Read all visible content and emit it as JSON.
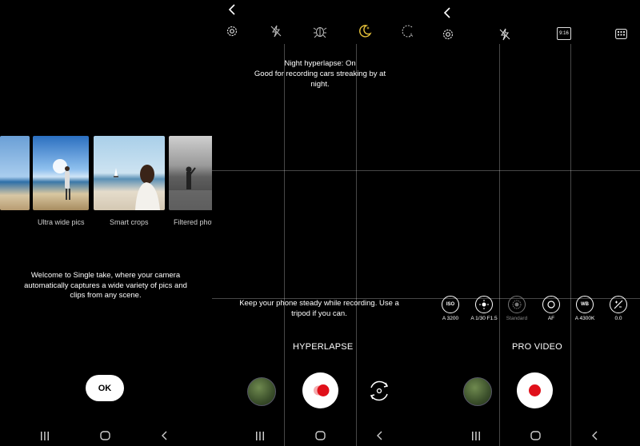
{
  "panel_single_take": {
    "thumbnails": [
      {
        "label": ""
      },
      {
        "label": "Ultra wide pics"
      },
      {
        "label": "Smart crops"
      },
      {
        "label": "Filtered phot"
      }
    ],
    "welcome_text": "Welcome to Single take, where your camera automatically captures a wide variety of pics and clips from any scene.",
    "ok_label": "OK"
  },
  "panel_hyperlapse": {
    "top_icons": [
      "settings-icon",
      "flash-off-icon",
      "night-bug-icon",
      "night-hyperlapse-icon",
      "auto-fps-icon"
    ],
    "night_title": "Night hyperlapse: On",
    "night_desc": "Good for recording cars streaking by at night.",
    "tip": "Keep your phone steady while recording. Use a tripod if you can.",
    "mode_label": "HYPERLAPSE",
    "accent_color": "#e8c33a",
    "record_color": "#e0101a"
  },
  "panel_pro_video": {
    "top_icons": [
      "settings-icon",
      "flash-off-icon",
      "aspect-ratio-icon",
      "grid-menu-icon"
    ],
    "aspect_label": "9:16",
    "controls": [
      {
        "name": "iso",
        "icon_text": "ISO",
        "value": "A 3200",
        "enabled": true
      },
      {
        "name": "shutter",
        "icon_text": "",
        "value": "A 1/30 F1.5",
        "enabled": true
      },
      {
        "name": "standard",
        "icon_text": "",
        "value": "Standard",
        "enabled": false
      },
      {
        "name": "af",
        "icon_text": "",
        "value": "AF",
        "enabled": true
      },
      {
        "name": "wb",
        "icon_text": "WB",
        "value": "A 4300K",
        "enabled": true
      },
      {
        "name": "ev",
        "icon_text": "",
        "value": "0.0",
        "enabled": true
      }
    ],
    "mode_label": "PRO VIDEO",
    "record_color": "#e0101a"
  }
}
